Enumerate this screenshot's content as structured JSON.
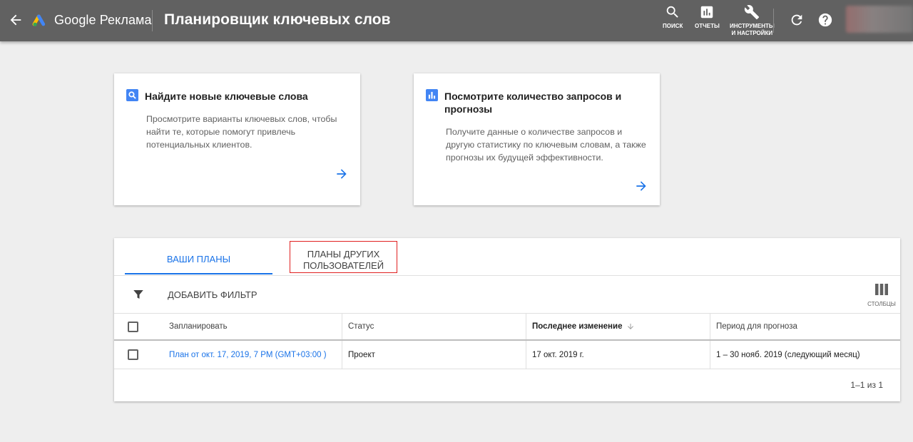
{
  "header": {
    "app_name": "Google Реклама",
    "page_title": "Планировщик ключевых слов",
    "actions": {
      "search": "ПОИСК",
      "reports": "ОТЧЕТЫ",
      "tools_line1": "ИНСТРУМЕНТЫ",
      "tools_line2": "И НАСТРОЙКИ"
    }
  },
  "cards": {
    "discover": {
      "title": "Найдите новые ключевые слова",
      "description": "Просмотрите варианты ключевых слов, чтобы найти те, которые помогут привлечь потенциальных клиентов."
    },
    "forecast": {
      "title": "Посмотрите количество запросов и прогнозы",
      "description": "Получите данные о количестве запросов и другую статистику по ключевым словам, а также прогнозы их будущей эффективности."
    }
  },
  "plans": {
    "tabs": {
      "mine": "ВАШИ ПЛАНЫ",
      "others_line1": "ПЛАНЫ ДРУГИХ",
      "others_line2": "ПОЛЬЗОВАТЕЛЕЙ"
    },
    "add_filter": "ДОБАВИТЬ ФИЛЬТР",
    "columns_label": "СТОЛБЦЫ",
    "table": {
      "headers": {
        "plan": "Запланировать",
        "status": "Статус",
        "last_modified": "Последнее изменение",
        "forecast_period": "Период для прогноза"
      },
      "rows": [
        {
          "plan": "План от окт. 17, 2019, 7 PM (GMT+03:00 )",
          "status": "Проект",
          "last_modified": "17 окт. 2019 г.",
          "forecast_period": "1 – 30 нояб. 2019 (следующий месяц)"
        }
      ]
    },
    "pagination": "1–1 из 1"
  },
  "colors": {
    "topbar": "#616161",
    "accent": "#1a73e8",
    "highlight_border": "#e02020",
    "background": "#eeeeee"
  },
  "icons": [
    "back-arrow-icon",
    "google-ads-logo-icon",
    "search-icon",
    "reports-icon",
    "wrench-icon",
    "refresh-icon",
    "help-icon",
    "search-card-icon",
    "bar-chart-icon",
    "arrow-right-icon",
    "filter-icon",
    "columns-icon",
    "sort-arrow-down-icon"
  ]
}
